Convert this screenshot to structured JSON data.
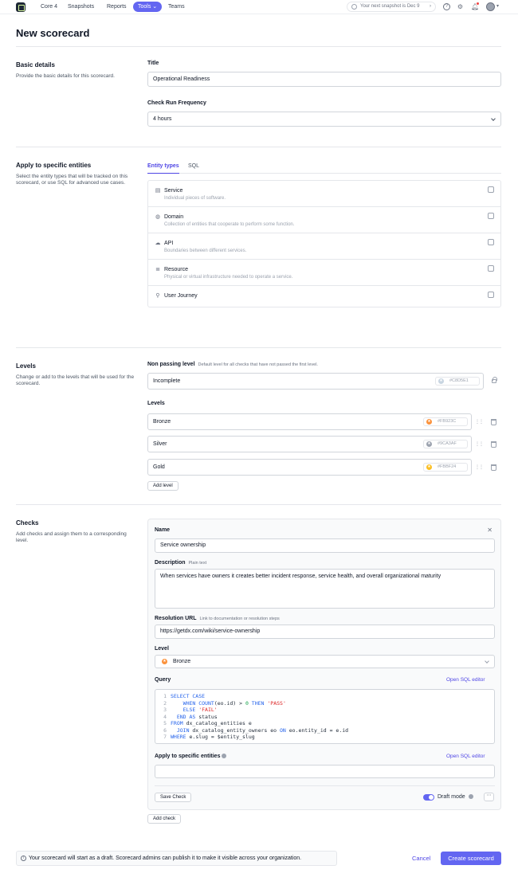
{
  "nav": {
    "items": [
      "Core 4",
      "Snapshots",
      "Reports",
      "Tools",
      "Teams"
    ],
    "active": "Tools",
    "snapshot_text": "Your next snapshot is Dec 9"
  },
  "page": {
    "title": "New scorecard"
  },
  "basic": {
    "title": "Basic details",
    "desc": "Provide the basic details for this scorecard.",
    "title_label": "Title",
    "title_value": "Operational Readiness",
    "freq_label": "Check Run Frequency",
    "freq_value": "4 hours"
  },
  "entities": {
    "title": "Apply to specific entities",
    "desc": "Select the entity types that will be tracked on this scorecard, or use SQL for advanced use cases.",
    "tabs": [
      "Entity types",
      "SQL"
    ],
    "items": [
      {
        "icon": "server-icon",
        "glyph": "▤",
        "name": "Service",
        "desc": "Individual pieces of software."
      },
      {
        "icon": "globe-icon",
        "glyph": "◍",
        "name": "Domain",
        "desc": "Collection of entities that cooperate to perform some function."
      },
      {
        "icon": "cloud-icon",
        "glyph": "☁",
        "name": "API",
        "desc": "Boundaries between different services."
      },
      {
        "icon": "database-icon",
        "glyph": "≣",
        "name": "Resource",
        "desc": "Physical or virtual infrastructure needed to operate a service."
      },
      {
        "icon": "user-icon",
        "glyph": "⚲",
        "name": "User Journey",
        "desc": ""
      }
    ]
  },
  "levels": {
    "title": "Levels",
    "desc": "Change or add to the levels that will be used for the scorecard.",
    "non_passing_label": "Non passing level",
    "non_passing_hint": "Default level for all checks that have not passed the first level.",
    "non_passing": {
      "name": "Incomplete",
      "color": "#C8D5E1"
    },
    "levels_label": "Levels",
    "items": [
      {
        "name": "Bronze",
        "color": "#FB923C"
      },
      {
        "name": "Silver",
        "color": "#9CA3AF"
      },
      {
        "name": "Gold",
        "color": "#FBBF24"
      }
    ],
    "add_label": "Add level"
  },
  "checks": {
    "title": "Checks",
    "desc": "Add checks and assign them to a corresponding level.",
    "name_label": "Name",
    "name_value": "Service ownership",
    "desc_label": "Description",
    "desc_hint": "Plain text",
    "desc_value": "When services have owners it creates better incident response, service health, and overall organizational maturity",
    "url_label": "Resolution URL",
    "url_hint": "Link to documentation or resolution steps",
    "url_value": "https://getdx.com/wiki/service-ownership",
    "level_label": "Level",
    "level_value": "Bronze",
    "query_label": "Query",
    "open_sql": "Open SQL editor",
    "query_lines": [
      "SELECT CASE",
      "    WHEN COUNT(eo.id) > 0 THEN 'PASS'",
      "    ELSE 'FAIL'",
      "  END AS status",
      "FROM dx_catalog_entities e",
      "  JOIN dx_catalog_entity_owners eo ON eo.entity_id = e.id",
      "WHERE e.slug = $entity_slug"
    ],
    "apply_label": "Apply to specific entities",
    "apply_value": "",
    "save_label": "Save Check",
    "draft_label": "Draft mode",
    "add_check": "Add check"
  },
  "footer": {
    "note": "Your scorecard will start as a draft. Scorecard admins can publish it to make it visible across your organization.",
    "cancel": "Cancel",
    "create": "Create scorecard"
  }
}
